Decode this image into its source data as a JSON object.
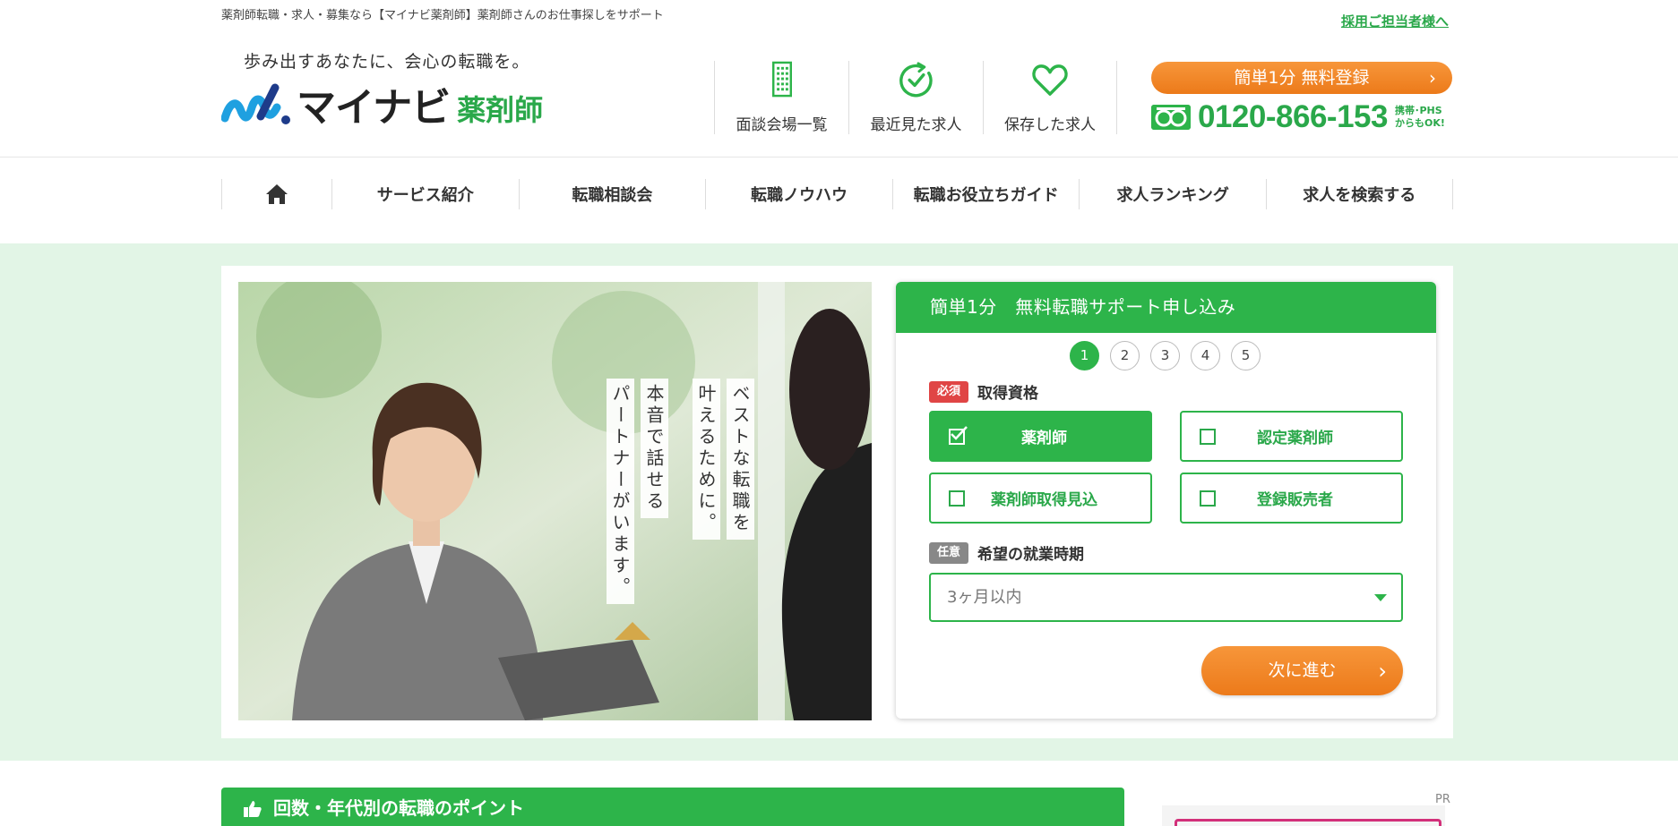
{
  "top": {
    "tagline": "薬剤師転職・求人・募集なら【マイナビ薬剤師】薬剤師さんのお仕事探しをサポート",
    "recruiter_link": "採用ご担当者様へ"
  },
  "header": {
    "catchphrase": "歩み出すあなたに、会心の転職を。",
    "logo_main": "マイナビ",
    "logo_sub": "薬剤師",
    "icons": [
      {
        "label": "面談会場一覧",
        "icon": "building-icon"
      },
      {
        "label": "最近見た求人",
        "icon": "clock-check-icon"
      },
      {
        "label": "保存した求人",
        "icon": "heart-icon"
      }
    ],
    "register_button": "簡単1分 無料登録",
    "phone_number": "0120-866-153",
    "phone_note_1": "携帯･PHS",
    "phone_note_2": "からもOK!"
  },
  "nav": {
    "items": [
      "サービス紹介",
      "転職相談会",
      "転職ノウハウ",
      "転職お役立ちガイド",
      "求人ランキング",
      "求人を検索する"
    ]
  },
  "hero": {
    "copy_col1": "ベストな転職を",
    "copy_col2": "叶えるために。",
    "copy_col3": "本音で話せる",
    "copy_col4": "パートナーがいます。"
  },
  "form": {
    "title": "簡単1分　無料転職サポート申し込み",
    "steps": [
      "1",
      "2",
      "3",
      "4",
      "5"
    ],
    "active_step": 1,
    "required_badge": "必須",
    "qualification_label": "取得資格",
    "options": [
      {
        "label": "薬剤師",
        "checked": true
      },
      {
        "label": "認定薬剤師",
        "checked": false
      },
      {
        "label": "薬剤師取得見込",
        "checked": false
      },
      {
        "label": "登録販売者",
        "checked": false
      }
    ],
    "optional_badge": "任意",
    "timing_label": "希望の就業時期",
    "timing_value": "3ヶ月以内",
    "next_button": "次に進む"
  },
  "bottom": {
    "points_title": "回数・年代別の転職のポイント",
    "pr_label": "PR"
  },
  "colors": {
    "brand_green": "#2db44a",
    "accent_orange": "#ec7a1a",
    "hero_bg": "#e2f5e6"
  }
}
